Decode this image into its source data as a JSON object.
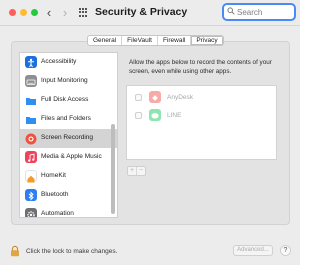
{
  "window": {
    "title": "Security & Privacy",
    "nav_back": "‹",
    "nav_forward": "›"
  },
  "search": {
    "placeholder": "Search",
    "value": ""
  },
  "tabs": [
    {
      "label": "General"
    },
    {
      "label": "FileVault"
    },
    {
      "label": "Firewall"
    },
    {
      "label": "Privacy",
      "active": true
    }
  ],
  "sidebar": {
    "items": [
      {
        "label": "Accessibility",
        "icon": "accessibility-icon",
        "color": "#1d6fe0"
      },
      {
        "label": "Input Monitoring",
        "icon": "keyboard-icon",
        "color": "#8e8e93"
      },
      {
        "label": "Full Disk Access",
        "icon": "folder-icon",
        "color": "#2f8ff0"
      },
      {
        "label": "Files and Folders",
        "icon": "folder-icon",
        "color": "#2f8ff0"
      },
      {
        "label": "Screen Recording",
        "icon": "screen-recording-icon",
        "color": "#f0523f",
        "selected": true
      },
      {
        "label": "Media & Apple Music",
        "icon": "music-icon",
        "color": "#f0425a"
      },
      {
        "label": "HomeKit",
        "icon": "home-icon",
        "color": "#f59a23"
      },
      {
        "label": "Bluetooth",
        "icon": "bluetooth-icon",
        "color": "#2f7ff0"
      },
      {
        "label": "Automation",
        "icon": "gear-icon",
        "color": "#6e6e73"
      }
    ]
  },
  "content": {
    "description": "Allow the apps below to record the contents of your screen, even while using other apps.",
    "apps": [
      {
        "name": "AnyDesk",
        "icon": "anydesk-icon",
        "color": "#ef443b",
        "checked": false
      },
      {
        "name": "LINE",
        "icon": "line-icon",
        "color": "#06c755",
        "checked": false
      }
    ],
    "add_label": "+",
    "remove_label": "−"
  },
  "footer": {
    "lock_text": "Click the lock to make changes.",
    "advanced_label": "Advanced...",
    "help_label": "?"
  }
}
